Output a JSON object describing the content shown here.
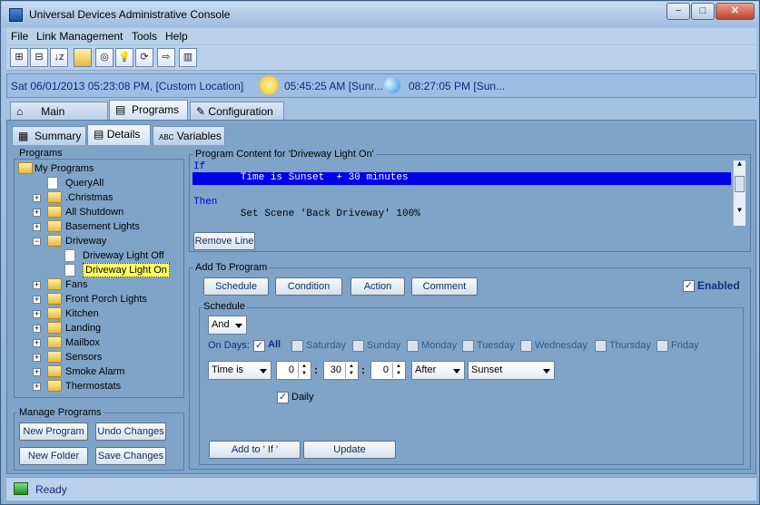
{
  "window": {
    "title": "Universal Devices Administrative Console",
    "min": "−",
    "max": "□",
    "close": "✕"
  },
  "menu": [
    "File",
    "Link Management",
    "Tools",
    "Help"
  ],
  "toolbar": [
    "expand-all-icon",
    "collapse-all-icon",
    "sort-icon",
    "folder-icon",
    "scenes-icon",
    "bulb-icon",
    "refresh-icon",
    "arrow-icon",
    "chart-icon"
  ],
  "info": {
    "date": "Sat 06/01/2013 05:23:08 PM,  [Custom Location]",
    "sunrise": "05:45:25 AM [Sunr...",
    "sunset": "08:27:05 PM [Sun..."
  },
  "tabs": {
    "main": "Main",
    "programs": "Programs",
    "configuration": "Configuration"
  },
  "subtabs": {
    "summary": "Summary",
    "details": "Details",
    "variables": "Variables"
  },
  "programs": {
    "label": "Programs",
    "tree": [
      {
        "label": "My Programs",
        "type": "folder",
        "level": 0
      },
      {
        "label": "QueryAll",
        "type": "program",
        "level": 1
      },
      {
        "label": ".Christmas",
        "type": "folder",
        "level": 1
      },
      {
        "label": "All Shutdown",
        "type": "folder",
        "level": 1
      },
      {
        "label": "Basement Lights",
        "type": "folder",
        "level": 1
      },
      {
        "label": "Driveway",
        "type": "folder",
        "level": 1
      },
      {
        "label": "Driveway Light Off",
        "type": "program",
        "level": 2
      },
      {
        "label": "Driveway Light On",
        "type": "program",
        "level": 2,
        "selected": true
      },
      {
        "label": "Fans",
        "type": "folder",
        "level": 1
      },
      {
        "label": "Front Porch Lights",
        "type": "folder",
        "level": 1
      },
      {
        "label": "Kitchen",
        "type": "folder",
        "level": 1
      },
      {
        "label": "Landing",
        "type": "folder",
        "level": 1
      },
      {
        "label": "Mailbox",
        "type": "folder",
        "level": 1
      },
      {
        "label": "Sensors",
        "type": "folder",
        "level": 1
      },
      {
        "label": "Smoke Alarm",
        "type": "folder",
        "level": 1
      },
      {
        "label": "Thermostats",
        "type": "folder",
        "level": 1
      }
    ]
  },
  "manage": {
    "label": "Manage Programs",
    "new_program": "New Program",
    "undo": "Undo Changes",
    "new_folder": "New Folder",
    "save": "Save Changes"
  },
  "content": {
    "label": "Program Content for 'Driveway Light On'",
    "if_kw": "If",
    "if_line": "        Time is Sunset  + 30 minutes",
    "then_kw": "Then",
    "then_line": "        Set Scene 'Back Driveway' 100%",
    "remove_line": "Remove Line"
  },
  "add": {
    "label": "Add To Program",
    "schedule": "Schedule",
    "condition": "Condition",
    "action": "Action",
    "comment": "Comment",
    "enabled": "Enabled"
  },
  "schedule": {
    "label": "Schedule",
    "and": "And",
    "on_days": "On Days:",
    "all": "All",
    "days": [
      "Saturday",
      "Sunday",
      "Monday",
      "Tuesday",
      "Wednesday",
      "Thursday",
      "Friday"
    ],
    "time_is": "Time is",
    "hours": "0",
    "minutes": "30",
    "seconds": "0",
    "after": "After",
    "sunset": "Sunset",
    "daily": "Daily",
    "add_to_if": "Add to ' If '",
    "update": "Update"
  },
  "status": {
    "text": "Ready"
  }
}
